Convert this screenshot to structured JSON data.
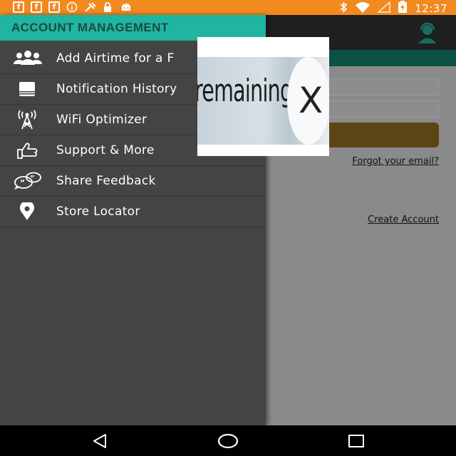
{
  "status_bar": {
    "time": "12:37",
    "left_icons": [
      "facebook-icon",
      "facebook-icon",
      "facebook-icon",
      "info-icon",
      "tools-icon",
      "lock-icon",
      "android-icon"
    ],
    "right_icons": [
      "bluetooth-icon",
      "wifi-icon",
      "signal-icon",
      "battery-charging-icon"
    ]
  },
  "drawer": {
    "header": "ACCOUNT MANAGEMENT",
    "items": [
      {
        "label": "Add Airtime for a F",
        "icon": "people-icon"
      },
      {
        "label": "Notification History",
        "icon": "notification-icon"
      },
      {
        "label": "WiFi Optimizer",
        "icon": "antenna-icon"
      },
      {
        "label": "Support & More",
        "icon": "thumbs-up-icon"
      },
      {
        "label": "Share Feedback",
        "icon": "feedback-bubbles-icon"
      },
      {
        "label": "Store Locator",
        "icon": "location-pin-icon"
      }
    ]
  },
  "background_app": {
    "forgot_link": "Forgot your email?",
    "create_link": "Create Account",
    "accent_color": "#1fb5a0"
  },
  "ad": {
    "text": "remaining",
    "close_glyph": "X"
  },
  "colors": {
    "status_bar": "#f28a1f",
    "drawer_header": "#1fb5a0",
    "drawer_bg": "#444444",
    "login_button": "#5c4515"
  }
}
